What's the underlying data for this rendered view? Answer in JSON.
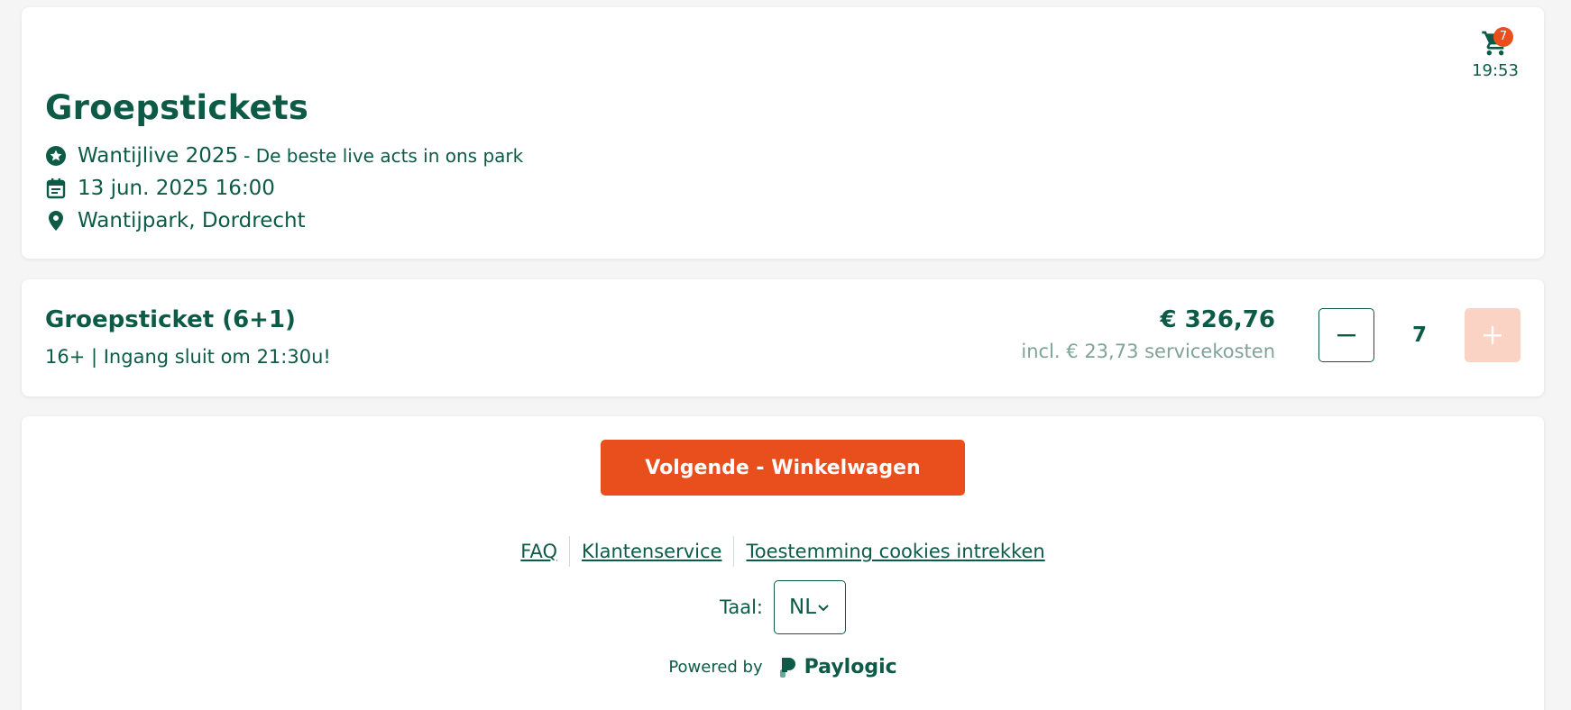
{
  "cart": {
    "count": "7",
    "timer": "19:53",
    "icon": "cart-icon"
  },
  "event": {
    "title": "Groepstickets",
    "name": "Wantijlive 2025",
    "tagline": "- De beste live acts in ons park",
    "date": "13 jun. 2025 16:00",
    "location": "Wantijpark, Dordrecht"
  },
  "ticket": {
    "name": "Groepsticket (6+1)",
    "description": "16+ | Ingang sluit om 21:30u!",
    "price": "€ 326,76",
    "fee": "incl. € 23,73 servicekosten",
    "quantity": "7"
  },
  "footer": {
    "next_label": "Volgende - Winkelwagen",
    "links": {
      "faq": "FAQ",
      "service": "Klantenservice",
      "cookies": "Toestemming cookies intrekken"
    },
    "language_label": "Taal:",
    "language_value": "NL",
    "powered_by": "Powered by",
    "brand": "Paylogic"
  },
  "colors": {
    "primary": "#0d5b46",
    "accent": "#e94f1d",
    "disabled_accent": "#fad3c5",
    "muted": "#7fa399"
  }
}
